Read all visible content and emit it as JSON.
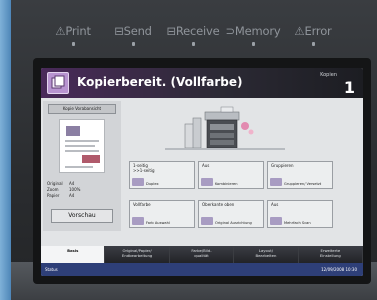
{
  "led_bar": [
    {
      "label": "⚠Print"
    },
    {
      "label": "⊟Send"
    },
    {
      "label": "⊟Receive"
    },
    {
      "label": "⊃Memory"
    },
    {
      "label": "⚠Error"
    }
  ],
  "header": {
    "title": "Kopierbereit. (Vollfarbe)",
    "copies_label": "Kopien",
    "copies_value": "1",
    "icon": "copy-icon"
  },
  "left_panel": {
    "preview_button": "Kopie Vorabansicht",
    "info": [
      {
        "key": "Original",
        "value": "A4"
      },
      {
        "key": "Zoom",
        "value": "100%"
      },
      {
        "key": "Papier",
        "value": "A4"
      }
    ],
    "bottom_button": "Vorschau"
  },
  "functions": [
    {
      "title": "1-seitig\n>>1-seitig",
      "sub": "Duplex"
    },
    {
      "title": "Aus",
      "sub": "Kombinieren"
    },
    {
      "title": "Gruppieren",
      "sub": "Gruppieren/ Versetzt"
    },
    {
      "title": "Vollfarbe",
      "sub": "Farb Auswahl"
    },
    {
      "title": "Oberkante oben",
      "sub": "Original Ausrichtung"
    },
    {
      "title": "Aus",
      "sub": "Mehrfach Scan"
    }
  ],
  "tabs": [
    {
      "label": "Basis"
    },
    {
      "label": "Original/Papier/\nEndbearbeitung"
    },
    {
      "label": "Farbe/Bild-\nqualität"
    },
    {
      "label": "Layout/\nBearbeiten"
    },
    {
      "label": "Erweiterte\nEinstellung"
    }
  ],
  "status": {
    "label": "Status",
    "time": "12/09/2008  10:30"
  },
  "colors": {
    "header_accent": "#4a2a5a",
    "icon_purple": "#b894d0",
    "status_blue": "#2e3f78"
  }
}
